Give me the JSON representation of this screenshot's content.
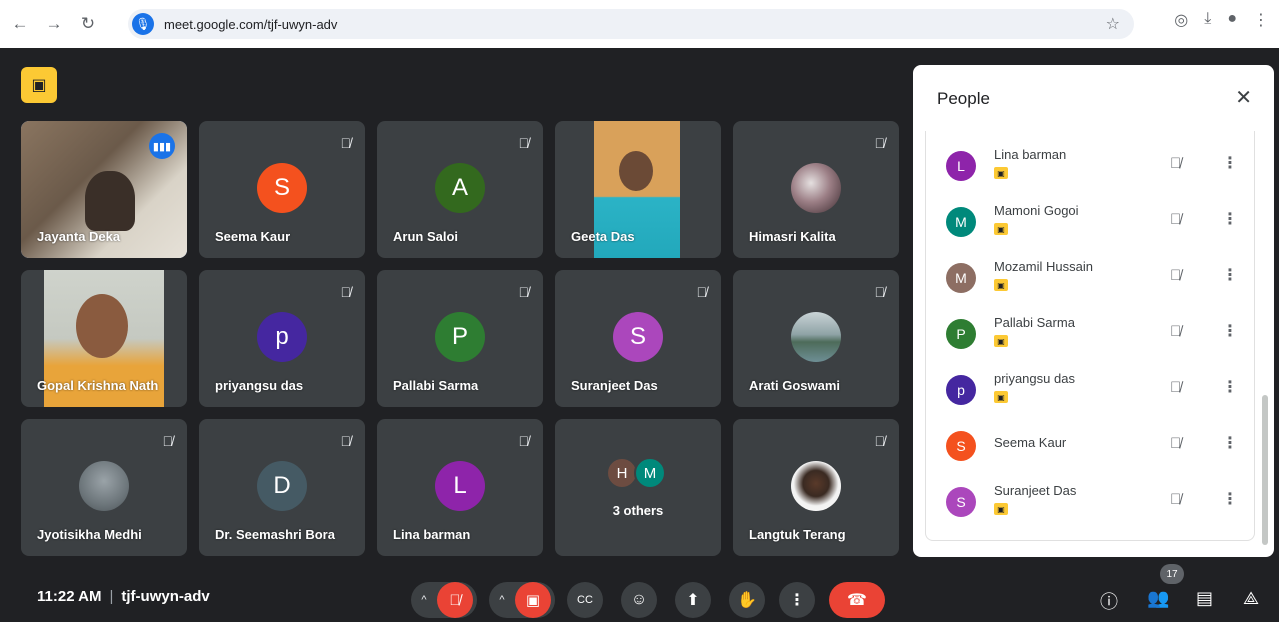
{
  "browser": {
    "url": "meet.google.com/tjf-uwyn-adv"
  },
  "tiles": [
    {
      "name": "Jayanta Deka"
    },
    {
      "name": "Seema Kaur",
      "initial": "S",
      "color": "#f4511e"
    },
    {
      "name": "Arun Saloi",
      "initial": "A",
      "color": "#33691e"
    },
    {
      "name": "Geeta Das"
    },
    {
      "name": "Himasri Kalita"
    },
    {
      "name": "Gopal Krishna Nath"
    },
    {
      "name": "priyangsu das",
      "initial": "p",
      "color": "#4527a0"
    },
    {
      "name": "Pallabi Sarma",
      "initial": "P",
      "color": "#2e7d32"
    },
    {
      "name": "Suranjeet Das",
      "initial": "S",
      "color": "#ab47bc"
    },
    {
      "name": "Arati Goswami"
    },
    {
      "name": "Jyotisikha Medhi"
    },
    {
      "name": "Dr. Seemashri Bora",
      "initial": "D",
      "color": "#455a64"
    },
    {
      "name": "Lina barman",
      "initial": "L",
      "color": "#8e24aa"
    },
    {
      "others": "3 others",
      "mini": [
        "H",
        "M"
      ]
    },
    {
      "name": "Langtuk Terang"
    }
  ],
  "panel": {
    "title": "People",
    "people": [
      {
        "name": "Lina barman",
        "initial": "L",
        "color": "#8e24aa"
      },
      {
        "name": "Mamoni Gogoi",
        "initial": "M",
        "color": "#00897b"
      },
      {
        "name": "Mozamil Hussain",
        "initial": "M",
        "color": "#8d6e63"
      },
      {
        "name": "Pallabi Sarma",
        "initial": "P",
        "color": "#2e7d32"
      },
      {
        "name": "priyangsu das",
        "initial": "p",
        "color": "#4527a0"
      },
      {
        "name": "Seema Kaur",
        "initial": "S",
        "color": "#f4511e"
      },
      {
        "name": "Suranjeet Das",
        "initial": "S",
        "color": "#ab47bc"
      }
    ]
  },
  "bottom": {
    "time": "11:22 AM",
    "meeting_code": "tjf-uwyn-adv",
    "participant_count": "17"
  }
}
